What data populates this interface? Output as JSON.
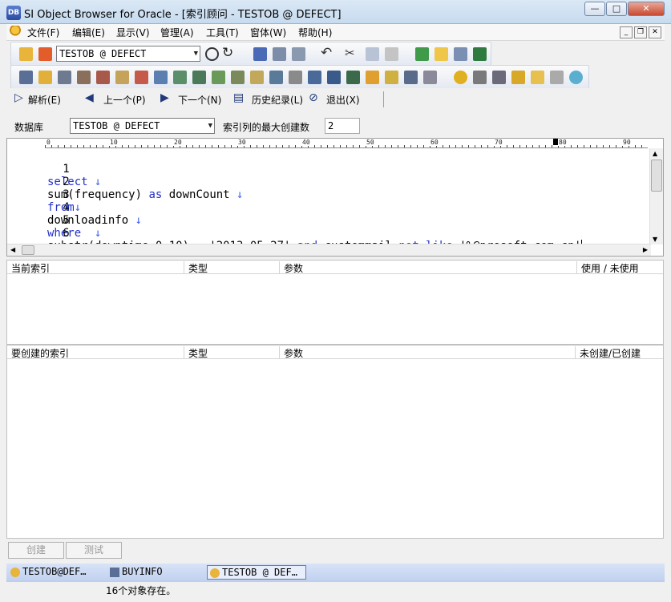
{
  "window": {
    "app_icon": "DB",
    "title": "SI Object Browser for Oracle - [索引顾问 - TESTOB @ DEFECT]",
    "min_label": "—",
    "max_label": "□",
    "close_label": "✕"
  },
  "menu": {
    "items": [
      "文件(F)",
      "编辑(E)",
      "显示(V)",
      "管理(A)",
      "工具(T)",
      "窗体(W)",
      "帮助(H)"
    ],
    "mdi_min": "_",
    "mdi_restore": "❐",
    "mdi_close": "✕"
  },
  "toolbar": {
    "connection_combo": "TESTOB @ DEFECT"
  },
  "nav": {
    "analyze": "解析(E)",
    "prev": "上一个(P)",
    "next": "下一个(N)",
    "history": "历史纪录(L)",
    "exit": "退出(X)"
  },
  "form": {
    "db_label": "数据库",
    "db_value": "TESTOB @ DEFECT",
    "max_label": "索引列的最大创建数",
    "max_value": "2"
  },
  "ruler": [
    "0",
    "10",
    "20",
    "30",
    "40",
    "50",
    "60",
    "70",
    "80",
    "90"
  ],
  "editor": {
    "line_numbers": [
      "1",
      "2",
      "3",
      "4",
      "5",
      "6"
    ],
    "lines": {
      "l1_kw": "select",
      "l2_a": "sum(frequency)",
      "l2_kw": "as",
      "l2_b": "downCount",
      "l3_kw": "from",
      "l4": "downloadinfo",
      "l5_kw": "where",
      "l6_a": "substr(downtime,0,10) = '2013-05-27'",
      "l6_and": "and",
      "l6_b": "custommail",
      "l6_not": "not",
      "l6_like": "like",
      "l6_c": "'%@presoft.com.cn'"
    },
    "newline_mark": "↓"
  },
  "current_index_table": {
    "headers": [
      "当前索引",
      "类型",
      "参数",
      "使用 / 未使用"
    ]
  },
  "create_index_table": {
    "headers": [
      "要创建的索引",
      "类型",
      "参数",
      "未创建/已创建"
    ]
  },
  "buttons": {
    "create": "创建",
    "test": "测试"
  },
  "taskbar": {
    "items": [
      "TESTOB@DEF…",
      "BUYINFO",
      "TESTOB @ DEF…"
    ]
  },
  "status": {
    "text": "16个对象存在。"
  },
  "colors": {
    "keyword": "#2431c9",
    "newline": "#3e5ff0",
    "taskbar": "#c0d0ee"
  }
}
